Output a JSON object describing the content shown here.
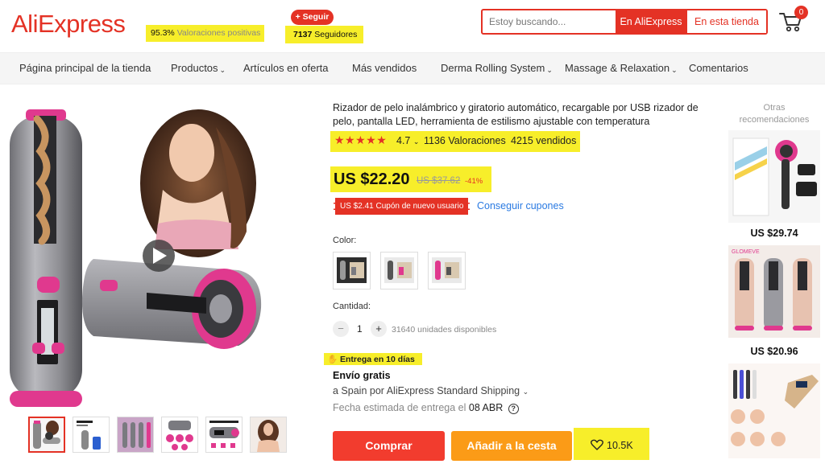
{
  "header": {
    "logo": "AliExpress",
    "positive_ratings_value": "95.3%",
    "positive_ratings_label": "Valoraciones positivas",
    "follow_button": "+ Seguir",
    "followers_value": "7137",
    "followers_label": "Seguidores",
    "search_placeholder": "Estoy buscando...",
    "search_aliexpress": "En AliExpress",
    "search_store": "En esta tienda",
    "cart_count": "0"
  },
  "nav": {
    "items": [
      {
        "label": "Página principal de la tienda",
        "dropdown": false
      },
      {
        "label": "Productos",
        "dropdown": true
      },
      {
        "label": "Artículos en oferta",
        "dropdown": false
      },
      {
        "label": "Más vendidos",
        "dropdown": false
      },
      {
        "label": "Derma Rolling System",
        "dropdown": true
      },
      {
        "label": "Massage & Relaxation",
        "dropdown": true
      },
      {
        "label": "Comentarios",
        "dropdown": false
      }
    ]
  },
  "product": {
    "title": "Rizador de pelo inalámbrico y giratorio automático, recargable por USB rizador de pelo, pantalla LED, herramienta de estilismo ajustable con temperatura",
    "rating": "4.7",
    "reviews": "1136 Valoraciones",
    "sold": "4215 vendidos",
    "price": "US $22.20",
    "old_price": "US $37.62",
    "discount": "-41%",
    "coupon": "US $2.41 Cupón de nuevo usuario",
    "get_coupons": "Conseguir cupones",
    "color_label": "Color:",
    "quantity_label": "Cantidad:",
    "quantity": "1",
    "available": "31640 unidades disponibles",
    "delivery_badge": "Entrega en 10 días",
    "shipping_title": "Envío gratis",
    "shipping_dest": "a Spain por AliExpress Standard Shipping",
    "delivery_date_label": "Fecha estimada de entrega el",
    "delivery_date": "08 ABR",
    "buy_button": "Comprar",
    "cart_button": "Añadir a la cesta",
    "wishlist_count": "10.5K"
  },
  "recommendations": {
    "title": "Otras recomendaciones",
    "items": [
      {
        "price": "US $29.74"
      },
      {
        "price": "US $20.96"
      },
      {
        "price": ""
      }
    ],
    "brand_mark": "GLOMEVE"
  },
  "colors": {
    "accent": "#e43225",
    "highlight": "#f7ee2a",
    "buy": "#f23c2e",
    "cart": "#fb9b17",
    "link": "#2a7ae2"
  }
}
